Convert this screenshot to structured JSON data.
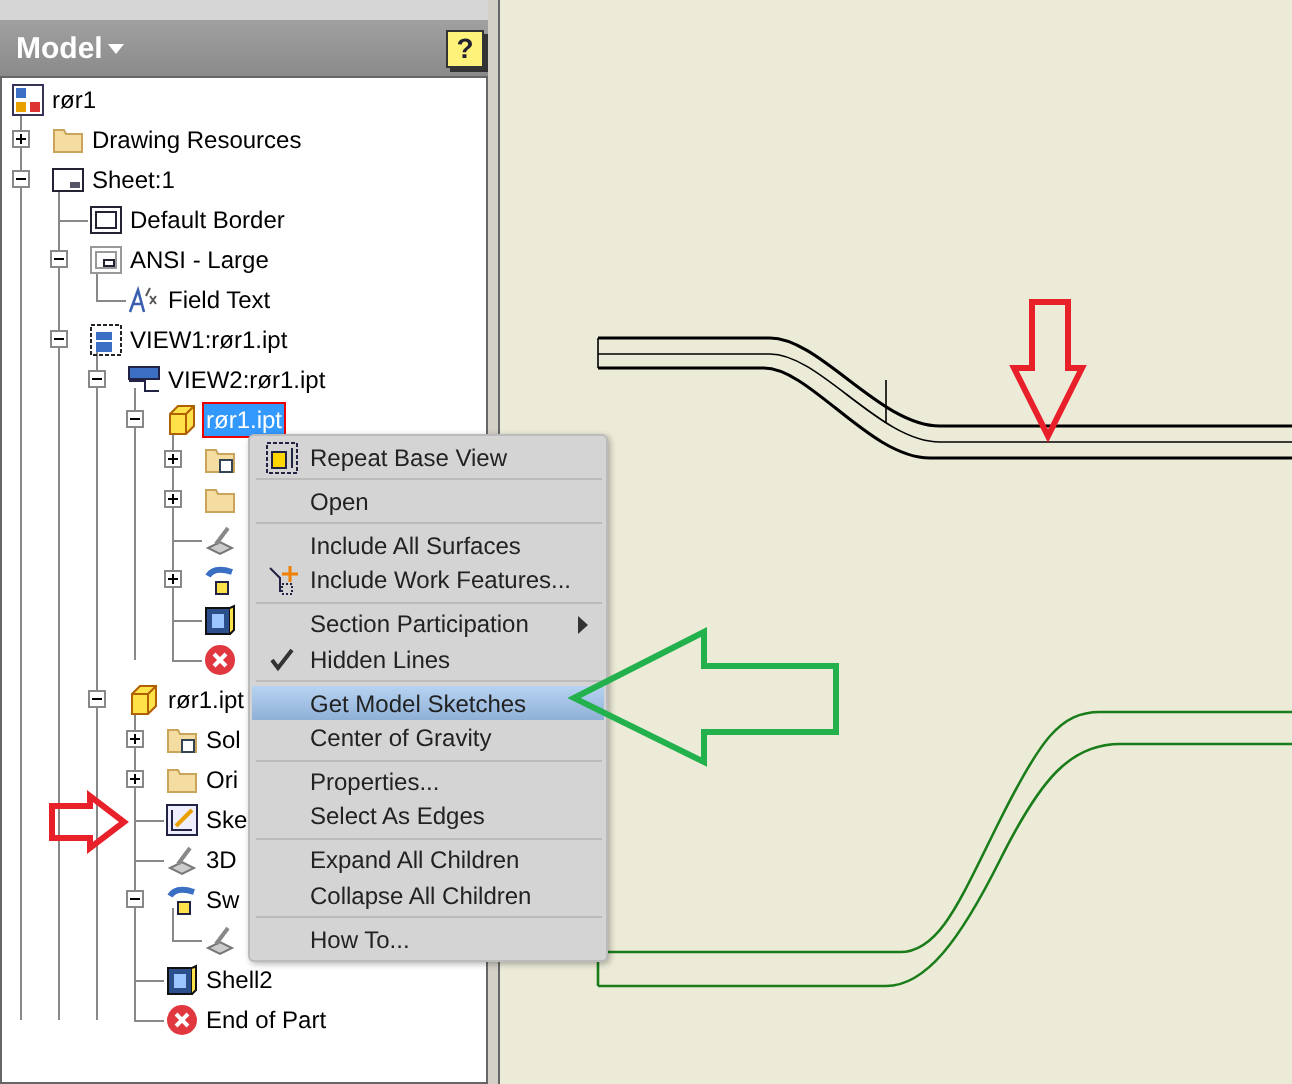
{
  "panel": {
    "title": "Model",
    "help": "?"
  },
  "tree": {
    "label": "rør1",
    "kind": "drawing",
    "selected": false,
    "children": [
      {
        "label": "Drawing Resources",
        "kind": "folder",
        "expanded": false,
        "selected": false
      },
      {
        "label": "Sheet:1",
        "kind": "sheet",
        "expanded": true,
        "selected": false,
        "children": [
          {
            "label": "Default Border",
            "kind": "border",
            "selected": false
          },
          {
            "label": "ANSI - Large",
            "kind": "title-block",
            "expanded": true,
            "selected": false,
            "children": [
              {
                "label": "Field Text",
                "kind": "field-text",
                "selected": false
              }
            ]
          },
          {
            "label": "VIEW1:rør1.ipt",
            "kind": "view",
            "expanded": true,
            "selected": false,
            "children": [
              {
                "label": "VIEW2:rør1.ipt",
                "kind": "section-view",
                "expanded": true,
                "selected": false,
                "children": [
                  {
                    "label": "rør1.ipt",
                    "kind": "part",
                    "expanded": true,
                    "selected": true,
                    "children": [
                      {
                        "kind": "bodies",
                        "expanded": false
                      },
                      {
                        "kind": "folder",
                        "expanded": false
                      },
                      {
                        "kind": "sketch3d"
                      },
                      {
                        "kind": "sweep",
                        "expanded": false
                      },
                      {
                        "kind": "shell"
                      },
                      {
                        "kind": "end"
                      }
                    ]
                  }
                ]
              },
              {
                "label": "rør1.ipt",
                "kind": "part",
                "expanded": true,
                "selected": false,
                "children": [
                  {
                    "label": "Sol",
                    "kind": "bodies",
                    "expanded": false,
                    "selected": false
                  },
                  {
                    "label": "Ori",
                    "kind": "folder",
                    "expanded": false,
                    "selected": false
                  },
                  {
                    "label": "Ske",
                    "kind": "sketch",
                    "selected": false
                  },
                  {
                    "label": "3D",
                    "kind": "sketch3d",
                    "selected": false
                  },
                  {
                    "label": "Sw",
                    "kind": "sweep",
                    "expanded": true,
                    "selected": false,
                    "children": [
                      {
                        "kind": "sketch3d"
                      }
                    ]
                  },
                  {
                    "label": "Shell2",
                    "kind": "shell",
                    "selected": false
                  },
                  {
                    "label": "End of Part",
                    "kind": "end",
                    "selected": false
                  }
                ]
              }
            ]
          }
        ]
      }
    ]
  },
  "context_menu": {
    "groups": [
      [
        {
          "label": "Repeat Base View",
          "selected": false,
          "checked": false,
          "submenu": false
        }
      ],
      [
        {
          "label": "Open",
          "selected": false,
          "checked": false,
          "submenu": false
        }
      ],
      [
        {
          "label": "Include All Surfaces",
          "selected": false,
          "checked": false,
          "submenu": false
        },
        {
          "label": "Include Work Features...",
          "selected": false,
          "checked": false,
          "submenu": false
        }
      ],
      [
        {
          "label": "Section Participation",
          "selected": false,
          "checked": false,
          "submenu": true
        },
        {
          "label": "Hidden Lines",
          "selected": false,
          "checked": true,
          "submenu": false
        }
      ],
      [
        {
          "label": "Get Model Sketches",
          "selected": true,
          "checked": false,
          "submenu": false
        },
        {
          "label": "Center of Gravity",
          "selected": false,
          "checked": false,
          "submenu": false
        }
      ],
      [
        {
          "label": "Properties...",
          "selected": false,
          "checked": false,
          "submenu": false
        },
        {
          "label": "Select As Edges",
          "selected": false,
          "checked": false,
          "submenu": false
        }
      ],
      [
        {
          "label": "Expand All Children",
          "selected": false,
          "checked": false,
          "submenu": false
        },
        {
          "label": "Collapse All Children",
          "selected": false,
          "checked": false,
          "submenu": false
        }
      ],
      [
        {
          "label": "How To...",
          "selected": false,
          "checked": false,
          "submenu": false
        }
      ]
    ]
  }
}
